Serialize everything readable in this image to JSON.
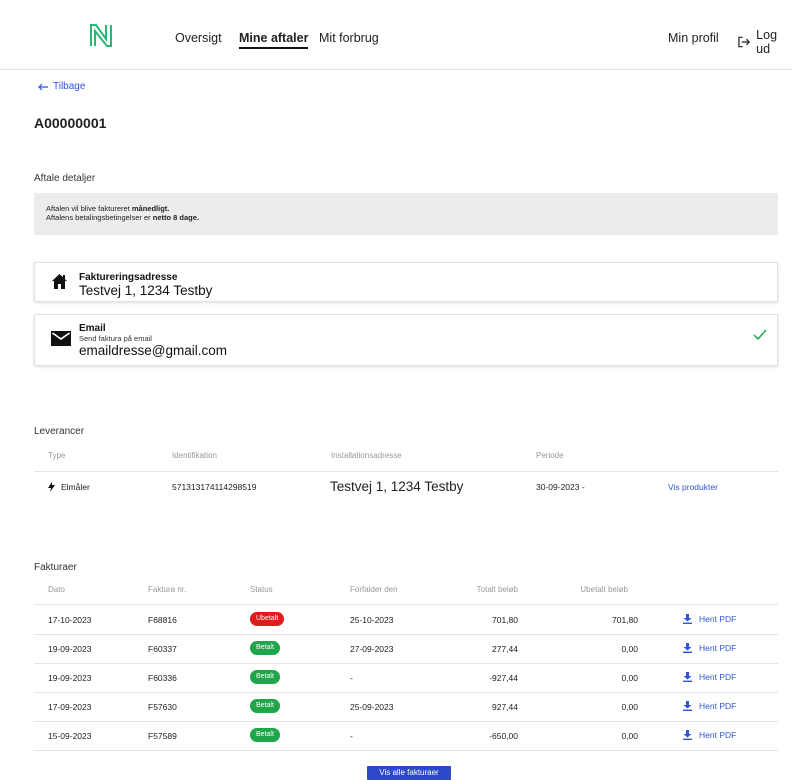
{
  "nav": {
    "items": [
      "Oversigt",
      "Mine aftaler",
      "Mit forbrug"
    ],
    "profile": "Min profil",
    "logout": "Log ud"
  },
  "back": "Tilbage",
  "title": "A00000001",
  "details": {
    "label": "Aftale detaljer",
    "line1_prefix": "Aftalen vil blive faktureret ",
    "line1_bold": "månedligt.",
    "line2_prefix": "Aftalens betalingsbetingelser er ",
    "line2_bold": "netto 8 dage."
  },
  "address_card": {
    "title": "Faktureringsadresse",
    "value": "Testvej 1, 1234 Testby"
  },
  "email_card": {
    "title": "Email",
    "subtitle": "Send faktura på email",
    "value": "emaildresse@gmail.com"
  },
  "leverancer": {
    "label": "Leverancer",
    "headers": [
      "Type",
      "Identifikation",
      "Installationsadresse",
      "Periode"
    ],
    "row": {
      "type": "Elmåler",
      "id": "571313174114298519",
      "address": "Testvej 1, 1234 Testby",
      "period": "30-09-2023 -",
      "link": "Vis produkter"
    }
  },
  "fakturaer": {
    "label": "Fakturaer",
    "headers": [
      "Dato",
      "Faktura nr.",
      "Status",
      "Forfalder den",
      "Totalt beløb",
      "Ubetalt beløb"
    ],
    "rows": [
      {
        "date": "17-10-2023",
        "nr": "F68816",
        "status": "Ubetalt",
        "due": "25-10-2023",
        "total": "701,80",
        "unpaid": "701,80",
        "action": "Hent PDF"
      },
      {
        "date": "19-09-2023",
        "nr": "F60337",
        "status": "Betalt",
        "due": "27-09-2023",
        "total": "277,44",
        "unpaid": "0,00",
        "action": "Hent PDF"
      },
      {
        "date": "19-09-2023",
        "nr": "F60336",
        "status": "Betalt",
        "due": "-",
        "total": "-927,44",
        "unpaid": "0,00",
        "action": "Hent PDF"
      },
      {
        "date": "17-09-2023",
        "nr": "F57630",
        "status": "Betalt",
        "due": "25-09-2023",
        "total": "927,44",
        "unpaid": "0,00",
        "action": "Hent PDF"
      },
      {
        "date": "15-09-2023",
        "nr": "F57589",
        "status": "Betalt",
        "due": "-",
        "total": "-650,00",
        "unpaid": "0,00",
        "action": "Hent PDF"
      }
    ],
    "button": "Vis alle fakturaer"
  },
  "colors": {
    "link": "#2f55d4",
    "unpaid": "#e01b1b",
    "paid": "#1fa54a",
    "button": "#2d48c9",
    "logo": "#2bb673"
  }
}
